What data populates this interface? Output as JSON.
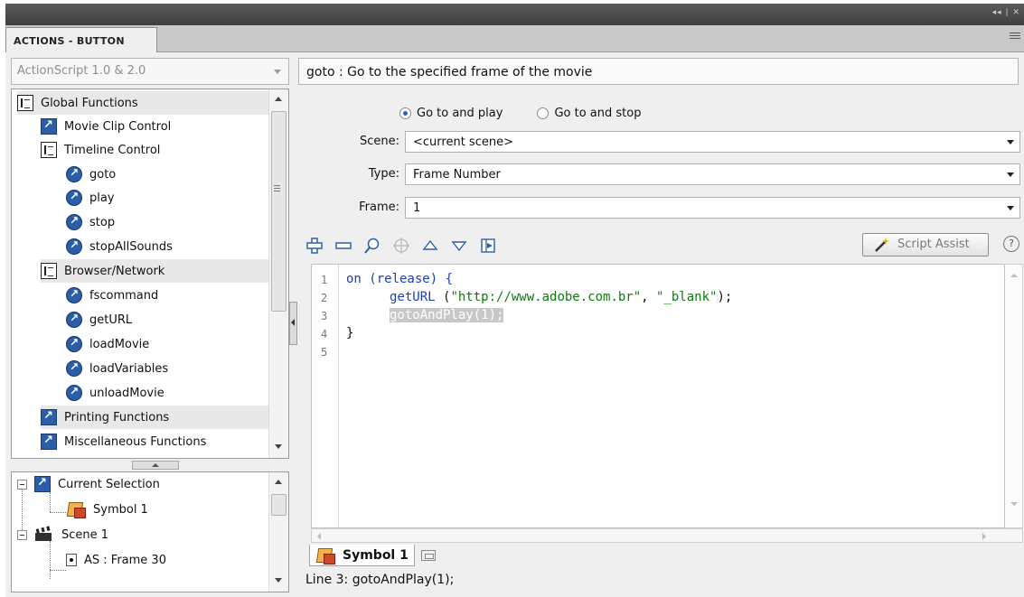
{
  "panel": {
    "title": "ACTIONS - BUTTON",
    "window_controls": "◂◂ | ✕"
  },
  "toolbox": {
    "language": "ActionScript 1.0 & 2.0",
    "items": [
      {
        "label": "Global Functions",
        "icon": "book-open-icon"
      },
      {
        "label": "Movie Clip Control",
        "icon": "book-closed-icon"
      },
      {
        "label": "Timeline Control",
        "icon": "book-open-icon"
      },
      {
        "label": "goto",
        "icon": "action-icon"
      },
      {
        "label": "play",
        "icon": "action-icon"
      },
      {
        "label": "stop",
        "icon": "action-icon"
      },
      {
        "label": "stopAllSounds",
        "icon": "action-icon"
      },
      {
        "label": "Browser/Network",
        "icon": "book-open-icon"
      },
      {
        "label": "fscommand",
        "icon": "action-icon"
      },
      {
        "label": "getURL",
        "icon": "action-icon"
      },
      {
        "label": "loadMovie",
        "icon": "action-icon"
      },
      {
        "label": "loadVariables",
        "icon": "action-icon"
      },
      {
        "label": "unloadMovie",
        "icon": "action-icon"
      },
      {
        "label": "Printing Functions",
        "icon": "book-closed-icon"
      },
      {
        "label": "Miscellaneous Functions",
        "icon": "book-closed-icon"
      }
    ]
  },
  "script_navigator": {
    "items": [
      {
        "label": "Current Selection",
        "icon": "book-closed-icon"
      },
      {
        "label": "Symbol 1",
        "icon": "symbol-icon"
      },
      {
        "label": "Scene 1",
        "icon": "scene-icon"
      },
      {
        "label": "AS : Frame 30",
        "icon": "frame-icon"
      }
    ]
  },
  "assist": {
    "description": "goto : Go to the specified frame of the movie",
    "radio_play": "Go to and play",
    "radio_stop": "Go to and stop",
    "selected_radio": "Go to and play",
    "scene_label": "Scene:",
    "scene_value": "<current scene>",
    "type_label": "Type:",
    "type_value": "Frame Number",
    "frame_label": "Frame:",
    "frame_value": "1"
  },
  "toolbar": {
    "script_assist_label": "Script Assist",
    "help_label": "?"
  },
  "editor": {
    "line_numbers": [
      "1",
      "2",
      "3",
      "4",
      "5"
    ],
    "line1_kw": "on",
    "line1_rest": " (release) {",
    "line2_fn": "getURL",
    "line2_paren": " (",
    "line2_str1": "\"http://www.adobe.com.br\"",
    "line2_comma": ", ",
    "line2_str2": "\"_blank\"",
    "line2_end": ");",
    "line3": "gotoAndPlay(1);",
    "line4": "}"
  },
  "script_tab": {
    "label": "Symbol 1"
  },
  "status": "Line 3: gotoAndPlay(1);"
}
